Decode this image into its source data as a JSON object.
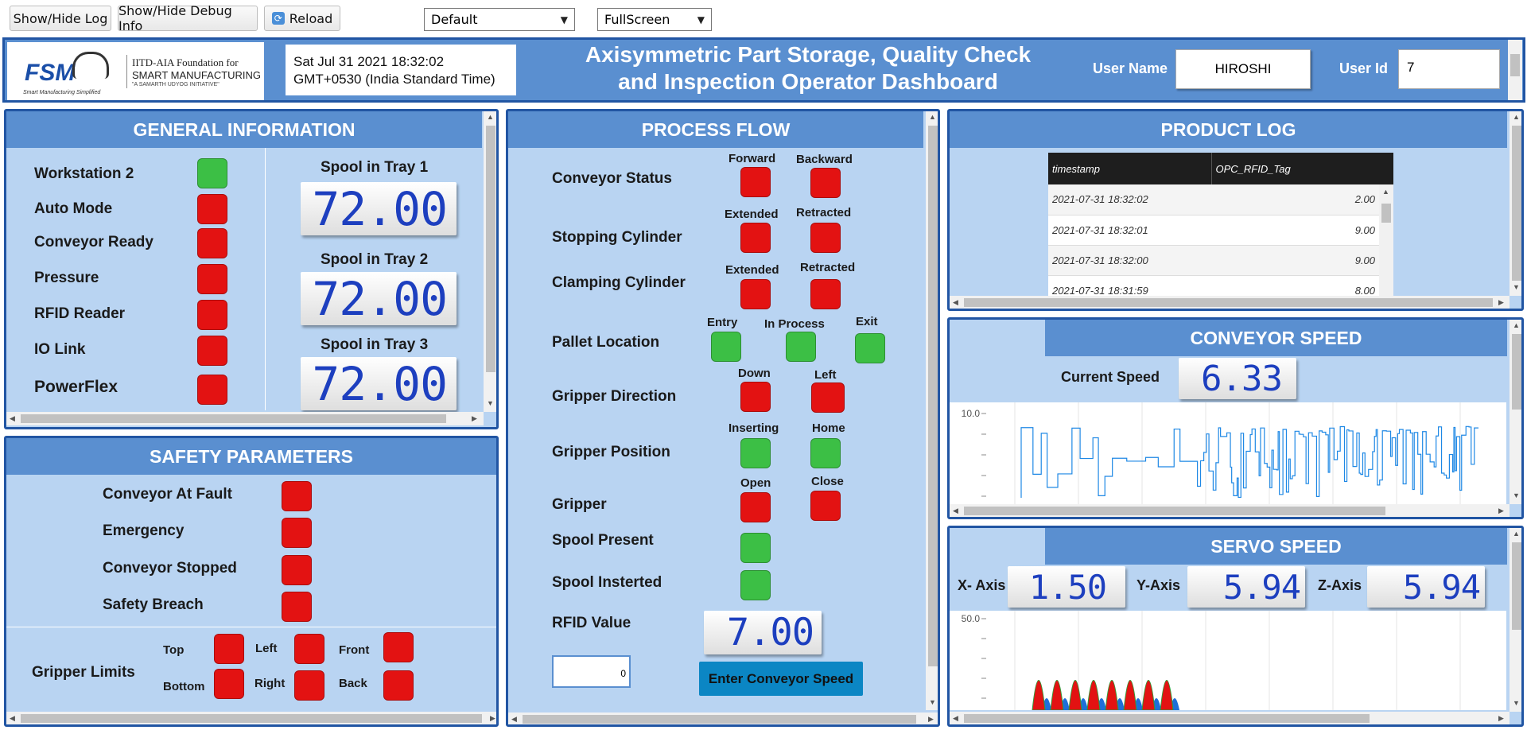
{
  "toolbar": {
    "show_hide_log": "Show/Hide Log",
    "show_hide_debug": "Show/Hide Debug Info",
    "reload": "Reload",
    "theme_select": "Default",
    "view_select": "FullScreen"
  },
  "header": {
    "logo_text": "FSM",
    "logo_tagline": "Smart Manufacturing Simplified",
    "org_line1": "IITD-AIA Foundation for",
    "org_line2": "SMART MANUFACTURING",
    "org_line3": "\"A SAMARTH UDYOG INITIATIVE\"",
    "datetime_line1": "Sat Jul 31 2021 18:32:02",
    "datetime_line2": "GMT+0530 (India Standard Time)",
    "title_line1": "Axisymmetric Part Storage, Quality Check",
    "title_line2": "and Inspection Operator Dashboard",
    "user_name_label": "User Name",
    "user_name_value": "HIROSHI",
    "user_id_label": "User Id",
    "user_id_value": "7"
  },
  "general": {
    "title": "GENERAL INFORMATION",
    "items": [
      {
        "label": "Workstation 2",
        "status": "green"
      },
      {
        "label": "Auto Mode",
        "status": "red"
      },
      {
        "label": "Conveyor Ready",
        "status": "red"
      },
      {
        "label": "Pressure",
        "status": "red"
      },
      {
        "label": "RFID Reader",
        "status": "red"
      },
      {
        "label": "IO Link",
        "status": "red"
      },
      {
        "label": "PowerFlex",
        "status": "red"
      }
    ],
    "spools": [
      {
        "label": "Spool in Tray 1",
        "value": "72.00"
      },
      {
        "label": "Spool in Tray 2",
        "value": "72.00"
      },
      {
        "label": "Spool in Tray 3",
        "value": "72.00"
      }
    ]
  },
  "safety": {
    "title": "SAFETY PARAMETERS",
    "items": [
      {
        "label": "Conveyor At Fault",
        "status": "red"
      },
      {
        "label": "Emergency",
        "status": "red"
      },
      {
        "label": "Conveyor Stopped",
        "status": "red"
      },
      {
        "label": "Safety Breach",
        "status": "red"
      }
    ],
    "gripper_limits_label": "Gripper Limits",
    "limits": {
      "top": "Top",
      "left": "Left",
      "front": "Front",
      "bottom": "Bottom",
      "right": "Right",
      "back": "Back"
    }
  },
  "process": {
    "title": "PROCESS FLOW",
    "conveyor_status": "Conveyor Status",
    "forward": "Forward",
    "backward": "Backward",
    "stopping_cylinder": "Stopping Cylinder",
    "extended": "Extended",
    "retracted": "Retracted",
    "clamping_cylinder": "Clamping Cylinder",
    "pallet_location": "Pallet Location",
    "entry": "Entry",
    "in_process": "In Process",
    "exit": "Exit",
    "gripper_direction": "Gripper Direction",
    "down": "Down",
    "left": "Left",
    "gripper_position": "Gripper Position",
    "inserting": "Inserting",
    "home": "Home",
    "gripper": "Gripper",
    "open": "Open",
    "close": "Close",
    "spool_present": "Spool Present",
    "spool_inserted": "Spool Insterted",
    "rfid_value_label": "RFID Value",
    "rfid_value": "7.00",
    "speed_input_value": "0",
    "enter_speed_button": "Enter Conveyor Speed"
  },
  "product_log": {
    "title": "PRODUCT LOG",
    "columns": [
      "timestamp",
      "OPC_RFID_Tag"
    ],
    "rows": [
      [
        "2021-07-31 18:32:02",
        "2.00"
      ],
      [
        "2021-07-31 18:32:01",
        "9.00"
      ],
      [
        "2021-07-31 18:32:00",
        "9.00"
      ],
      [
        "2021-07-31 18:31:59",
        "8.00"
      ]
    ]
  },
  "conveyor_speed": {
    "title": "CONVEYOR SPEED",
    "current_label": "Current Speed",
    "current_value": "6.33",
    "y_tick_top": "10.0"
  },
  "servo_speed": {
    "title": "SERVO SPEED",
    "x_label": "X- Axis",
    "x_value": "1.50",
    "y_label": "Y-Axis",
    "y_value": "5.94",
    "z_label": "Z-Axis",
    "z_value": "5.94",
    "y_tick_top": "50.0"
  },
  "colors": {
    "panel_bg": "#b9d4f2",
    "header_bg": "#5a8fd0",
    "border": "#2155a3",
    "led_red": "#e31212",
    "led_green": "#3cbf45",
    "lcd_digits": "#1d3fbf",
    "button_teal": "#0b86c4",
    "chart_line": "#1e88e5"
  }
}
